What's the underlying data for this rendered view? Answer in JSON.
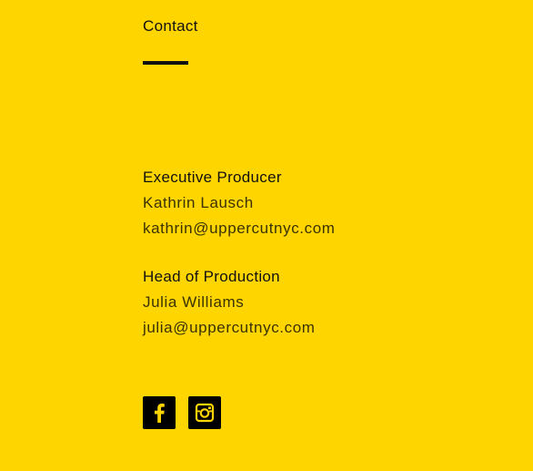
{
  "section": {
    "title": "Contact"
  },
  "contacts": [
    {
      "role": "Executive Producer",
      "name": "Kathrin Lausch",
      "email": "kathrin@uppercutnyc.com"
    },
    {
      "role": "Head of Production",
      "name": "Julia Williams",
      "email": "julia@uppercutnyc.com"
    }
  ],
  "social": [
    {
      "icon": "facebook-icon"
    },
    {
      "icon": "instagram-icon"
    }
  ],
  "colors": {
    "background": "#FFD500",
    "text": "#111111",
    "icon_bg": "#000000"
  }
}
